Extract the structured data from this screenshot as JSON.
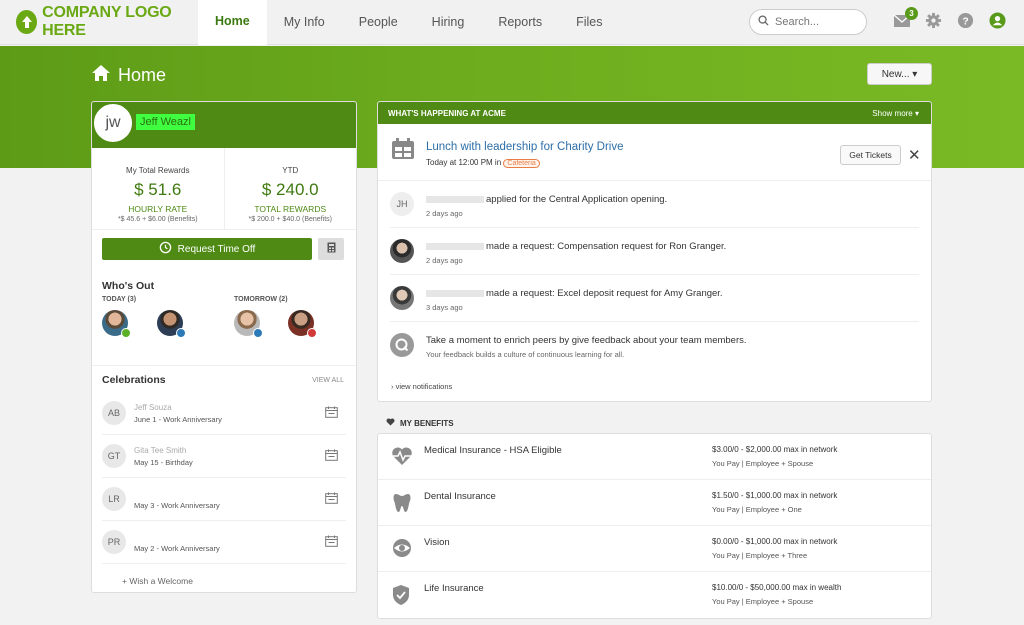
{
  "nav": {
    "logo": "COMPANY LOGO HERE",
    "tabs": [
      "Home",
      "My Info",
      "People",
      "Hiring",
      "Reports",
      "Files"
    ],
    "search_placeholder": "Search...",
    "mail_count": "3"
  },
  "page": {
    "title": "Home",
    "new_button": "New... ▾"
  },
  "profile": {
    "initials": "jw",
    "name": "Jeff Weazl",
    "total_rewards_label": "My Total Rewards",
    "total_rewards_value": "$ 51.6",
    "total_rewards_sub": "HOURLY RATE",
    "total_rewards_note": "*$ 45.6 + $6.00 (Benefits)",
    "ytd_label": "YTD",
    "ytd_value": "$ 240.0",
    "ytd_sub": "TOTAL REWARDS",
    "ytd_note": "*$ 200.0 + $40.0 (Benefits)",
    "request_time_off": "Request Time Off"
  },
  "whos_out": {
    "title": "Who's Out",
    "today_label": "TODAY (3)",
    "tomorrow_label": "TOMORROW (2)"
  },
  "celebrations": {
    "title": "Celebrations",
    "view_all": "VIEW ALL",
    "items": [
      {
        "initials": "AB",
        "name": "Jeff Souza",
        "date": "June 1 - Work Anniversary"
      },
      {
        "initials": "GT",
        "name": "Gita Tee Smith",
        "date": "May 15 - Birthday"
      },
      {
        "initials": "LR",
        "name": "",
        "date": "May 3 - Work Anniversary"
      },
      {
        "initials": "PR",
        "name": "",
        "date": "May 2 - Work Anniversary"
      }
    ],
    "wish_welcome": "+ Wish a Welcome"
  },
  "happening": {
    "title": "WHAT'S HAPPENING AT ACME",
    "show_more": "Show more ▾",
    "event_title": "Lunch with leadership for Charity Drive",
    "event_time": "Today at 12:00 PM in",
    "event_location": "Cafeteria",
    "get_tickets": "Get Tickets",
    "feed": [
      {
        "avatar": "JH",
        "text": "applied for the Central Application opening.",
        "time": "2 days ago"
      },
      {
        "avatar": "",
        "text": "made a request: Compensation request for Ron Granger.",
        "time": "2 days ago"
      },
      {
        "avatar": "",
        "text": "made a request: Excel deposit request for Amy Granger.",
        "time": "3 days ago"
      },
      {
        "avatar": "Q",
        "text": "Take a moment to enrich peers by give feedback about your team members.",
        "time": "Your feedback builds a culture of continuous learning for all."
      }
    ],
    "view_notifications": "› view notifications"
  },
  "benefits": {
    "title": "MY BENEFITS",
    "items": [
      {
        "icon": "heartbeat-icon",
        "name": "Medical Insurance - HSA Eligible",
        "price": "$3.00/0 - $2,000.00 max in network",
        "pay": "You Pay  |  Employee + Spouse"
      },
      {
        "icon": "tooth-icon",
        "name": "Dental Insurance",
        "price": "$1.50/0 - $1,000.00 max in network",
        "pay": "You Pay  |  Employee + One"
      },
      {
        "icon": "eye-icon",
        "name": "Vision",
        "price": "$0.00/0 - $1,000.00 max in network",
        "pay": "You Pay  |  Employee + Three"
      },
      {
        "icon": "shield-icon",
        "name": "Life Insurance",
        "price": "$10.00/0 - $50,000.00 max in wealth",
        "pay": "You Pay  |  Employee + Spouse"
      }
    ]
  },
  "colors": {
    "brand_green": "#4f8b14",
    "link_blue": "#2c6ea8",
    "tag_orange": "#e97d45"
  }
}
